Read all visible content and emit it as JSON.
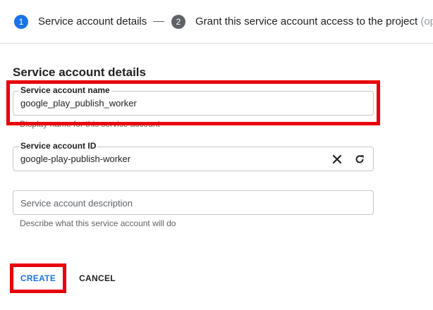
{
  "stepper": {
    "step1_number": "1",
    "step1_label": "Service account details",
    "step2_number": "2",
    "step2_label": "Grant this service account access to the project",
    "step2_suffix": "(op"
  },
  "form": {
    "title": "Service account details",
    "name_label": "Service account name",
    "name_value": "google_play_publish_worker",
    "name_hint": "Display name for this service account",
    "id_label": "Service account ID",
    "id_value": "google-play-publish-worker",
    "description_placeholder": "Service account description",
    "description_hint": "Describe what this service account will do"
  },
  "actions": {
    "create_label": "CREATE",
    "cancel_label": "CANCEL"
  },
  "colors": {
    "accent": "#1a73e8",
    "highlight": "#e8000b"
  },
  "icons": {
    "clear": "close-icon",
    "refresh": "refresh-icon"
  }
}
